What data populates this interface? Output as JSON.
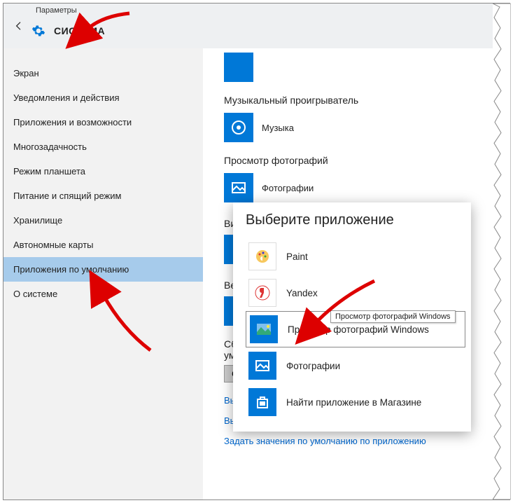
{
  "header": {
    "breadcrumb": "Параметры",
    "title": "СИСТЕМА"
  },
  "sidebar": {
    "items": [
      "Экран",
      "Уведомления и действия",
      "Приложения и возможности",
      "Многозадачность",
      "Режим планшета",
      "Питание и спящий режим",
      "Хранилище",
      "Автономные карты",
      "Приложения по умолчанию",
      "О системе"
    ],
    "selected_index": 8
  },
  "content": {
    "music_section": "Музыкальный проигрыватель",
    "music_app": "Музыка",
    "photo_section": "Просмотр фотографий",
    "photo_app": "Фотографии",
    "video_cut": "Видес",
    "web_cut": "Веб-б",
    "reset_line1": "Сброс",
    "reset_line2": "умолч",
    "reset_btn": "Сбр",
    "link_cut": "Выбор",
    "link_protocols": "Выбор стандартных приложений для протоколов",
    "link_by_app": "Задать значения по умолчанию по приложению"
  },
  "popup": {
    "title": "Выберите приложение",
    "items": [
      "Paint",
      "Yandex",
      "Просмотр фотографий Windows",
      "Фотографии",
      "Найти приложение в Магазине"
    ],
    "tooltip": "Просмотр фотографий Windows"
  }
}
